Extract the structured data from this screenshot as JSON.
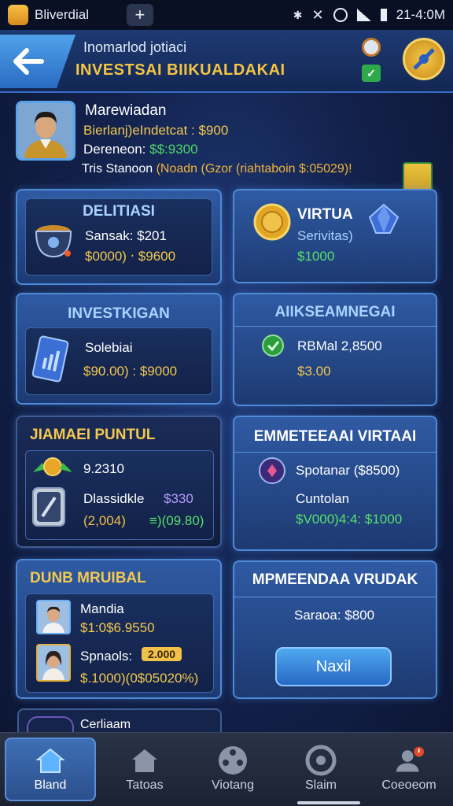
{
  "status_bar": {
    "app_name": "Bliverdial",
    "plus_label": "+",
    "time": "21-4:0M"
  },
  "header": {
    "subtitle": "Inomarlod jotiaci",
    "title": "INVESTSAI BIIKUALDAKAI",
    "check_badge": "✓"
  },
  "profile": {
    "name": "Marewiadan",
    "line1": "Bierlanj)eIndetcat : $900",
    "line2_prefix": "Dereneon: ",
    "line2_value": "$$:9300",
    "line3_prefix": "Tris Stanoon ",
    "line3_highlight": "(Noadn (Gzor (riahtaboin $:05029)!"
  },
  "cards": {
    "c1": {
      "title": "DELITIASI",
      "line1": "Sansak: $201",
      "line2": "$0000) ‧ $9600"
    },
    "c2": {
      "title": "VIRTUA",
      "line1": "Serivitas)",
      "line2": "$1000"
    },
    "c3": {
      "title": "INVESTKIGAN",
      "line1": "Solebiai",
      "line2": "$90.00) : $9000"
    },
    "c4": {
      "title": "AIIKSEAMNEGAI",
      "line1": "RBMal 2,8500",
      "line2": "$3.00"
    },
    "c5": {
      "title": "JIAMAEI PUNTUL",
      "line1": "9.2310",
      "line2": "Dlassidkle",
      "line2_value": "$330",
      "line3_a": "(2,004)",
      "line3_b": "≡)(09.80)"
    },
    "c6": {
      "title": "EMMETEEAAI VIRTAAI",
      "line1": "Spotanar ($8500)",
      "line2": "Cuntolan",
      "line3": "$V000)4:4: $1000"
    },
    "c7": {
      "title": "DUNB MRUIBAL",
      "p1_name": "Mandia",
      "p1_value": "$1:0$6.9550",
      "p2_name": "Spnaols:",
      "p2_badge": "2.000",
      "p2_value": "$.1000)(0$05020%)"
    },
    "c8": {
      "title": "MPMEENDAA VRUDAK",
      "line1": "Saraoa: $800",
      "button": "Naxil"
    }
  },
  "partial_card": {
    "label": "Cerliaam"
  },
  "bottom_nav": [
    {
      "label": "Bland",
      "icon": "home-icon",
      "active": true
    },
    {
      "label": "Tatoas",
      "icon": "house-icon",
      "active": false
    },
    {
      "label": "Viotang",
      "icon": "film-reel-icon",
      "active": false
    },
    {
      "label": "Slaim",
      "icon": "target-icon",
      "active": false
    },
    {
      "label": "Coeoeom",
      "icon": "user-notification-icon",
      "active": false
    }
  ],
  "colors": {
    "accent": "#4d8ad8",
    "gold": "#f3c94f",
    "green": "#57e06c"
  }
}
